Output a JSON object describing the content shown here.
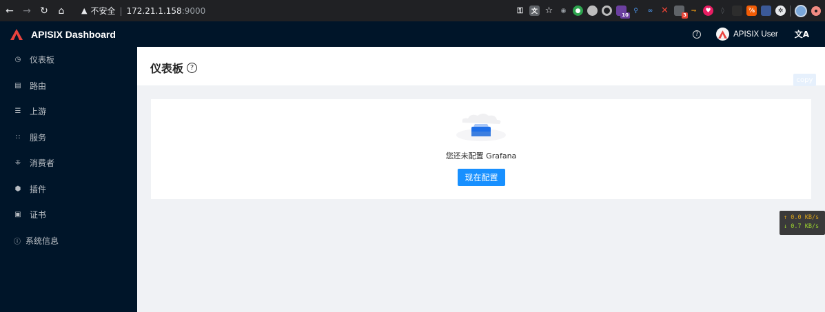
{
  "browser": {
    "security_label": "不安全",
    "url_host": "172.21.1.158",
    "url_port": ":9000",
    "extension_badges": [
      "10",
      "3"
    ]
  },
  "header": {
    "title": "APISIX Dashboard",
    "user_name": "APISIX User",
    "help_symbol": "?",
    "lang_symbol": "文A"
  },
  "sidebar": {
    "items": [
      {
        "label": "仪表板",
        "icon": "dashboard-icon"
      },
      {
        "label": "路由",
        "icon": "route-icon"
      },
      {
        "label": "上游",
        "icon": "upstream-icon"
      },
      {
        "label": "服务",
        "icon": "service-icon"
      },
      {
        "label": "消费者",
        "icon": "consumer-icon"
      },
      {
        "label": "插件",
        "icon": "plugin-icon"
      },
      {
        "label": "证书",
        "icon": "ssl-icon"
      },
      {
        "label": "系统信息",
        "icon": "info-icon"
      }
    ]
  },
  "main": {
    "page_title": "仪表板",
    "copy_label": "copy",
    "empty_text": "您还未配置 Grafana",
    "config_button": "现在配置"
  },
  "net_speed": {
    "up": "↑ 0.0 KB/s",
    "down": "↓ 0.7 KB/s"
  },
  "colors": {
    "sidebar_bg": "#001529",
    "primary": "#1890ff",
    "logo_red": "#e8433e"
  }
}
